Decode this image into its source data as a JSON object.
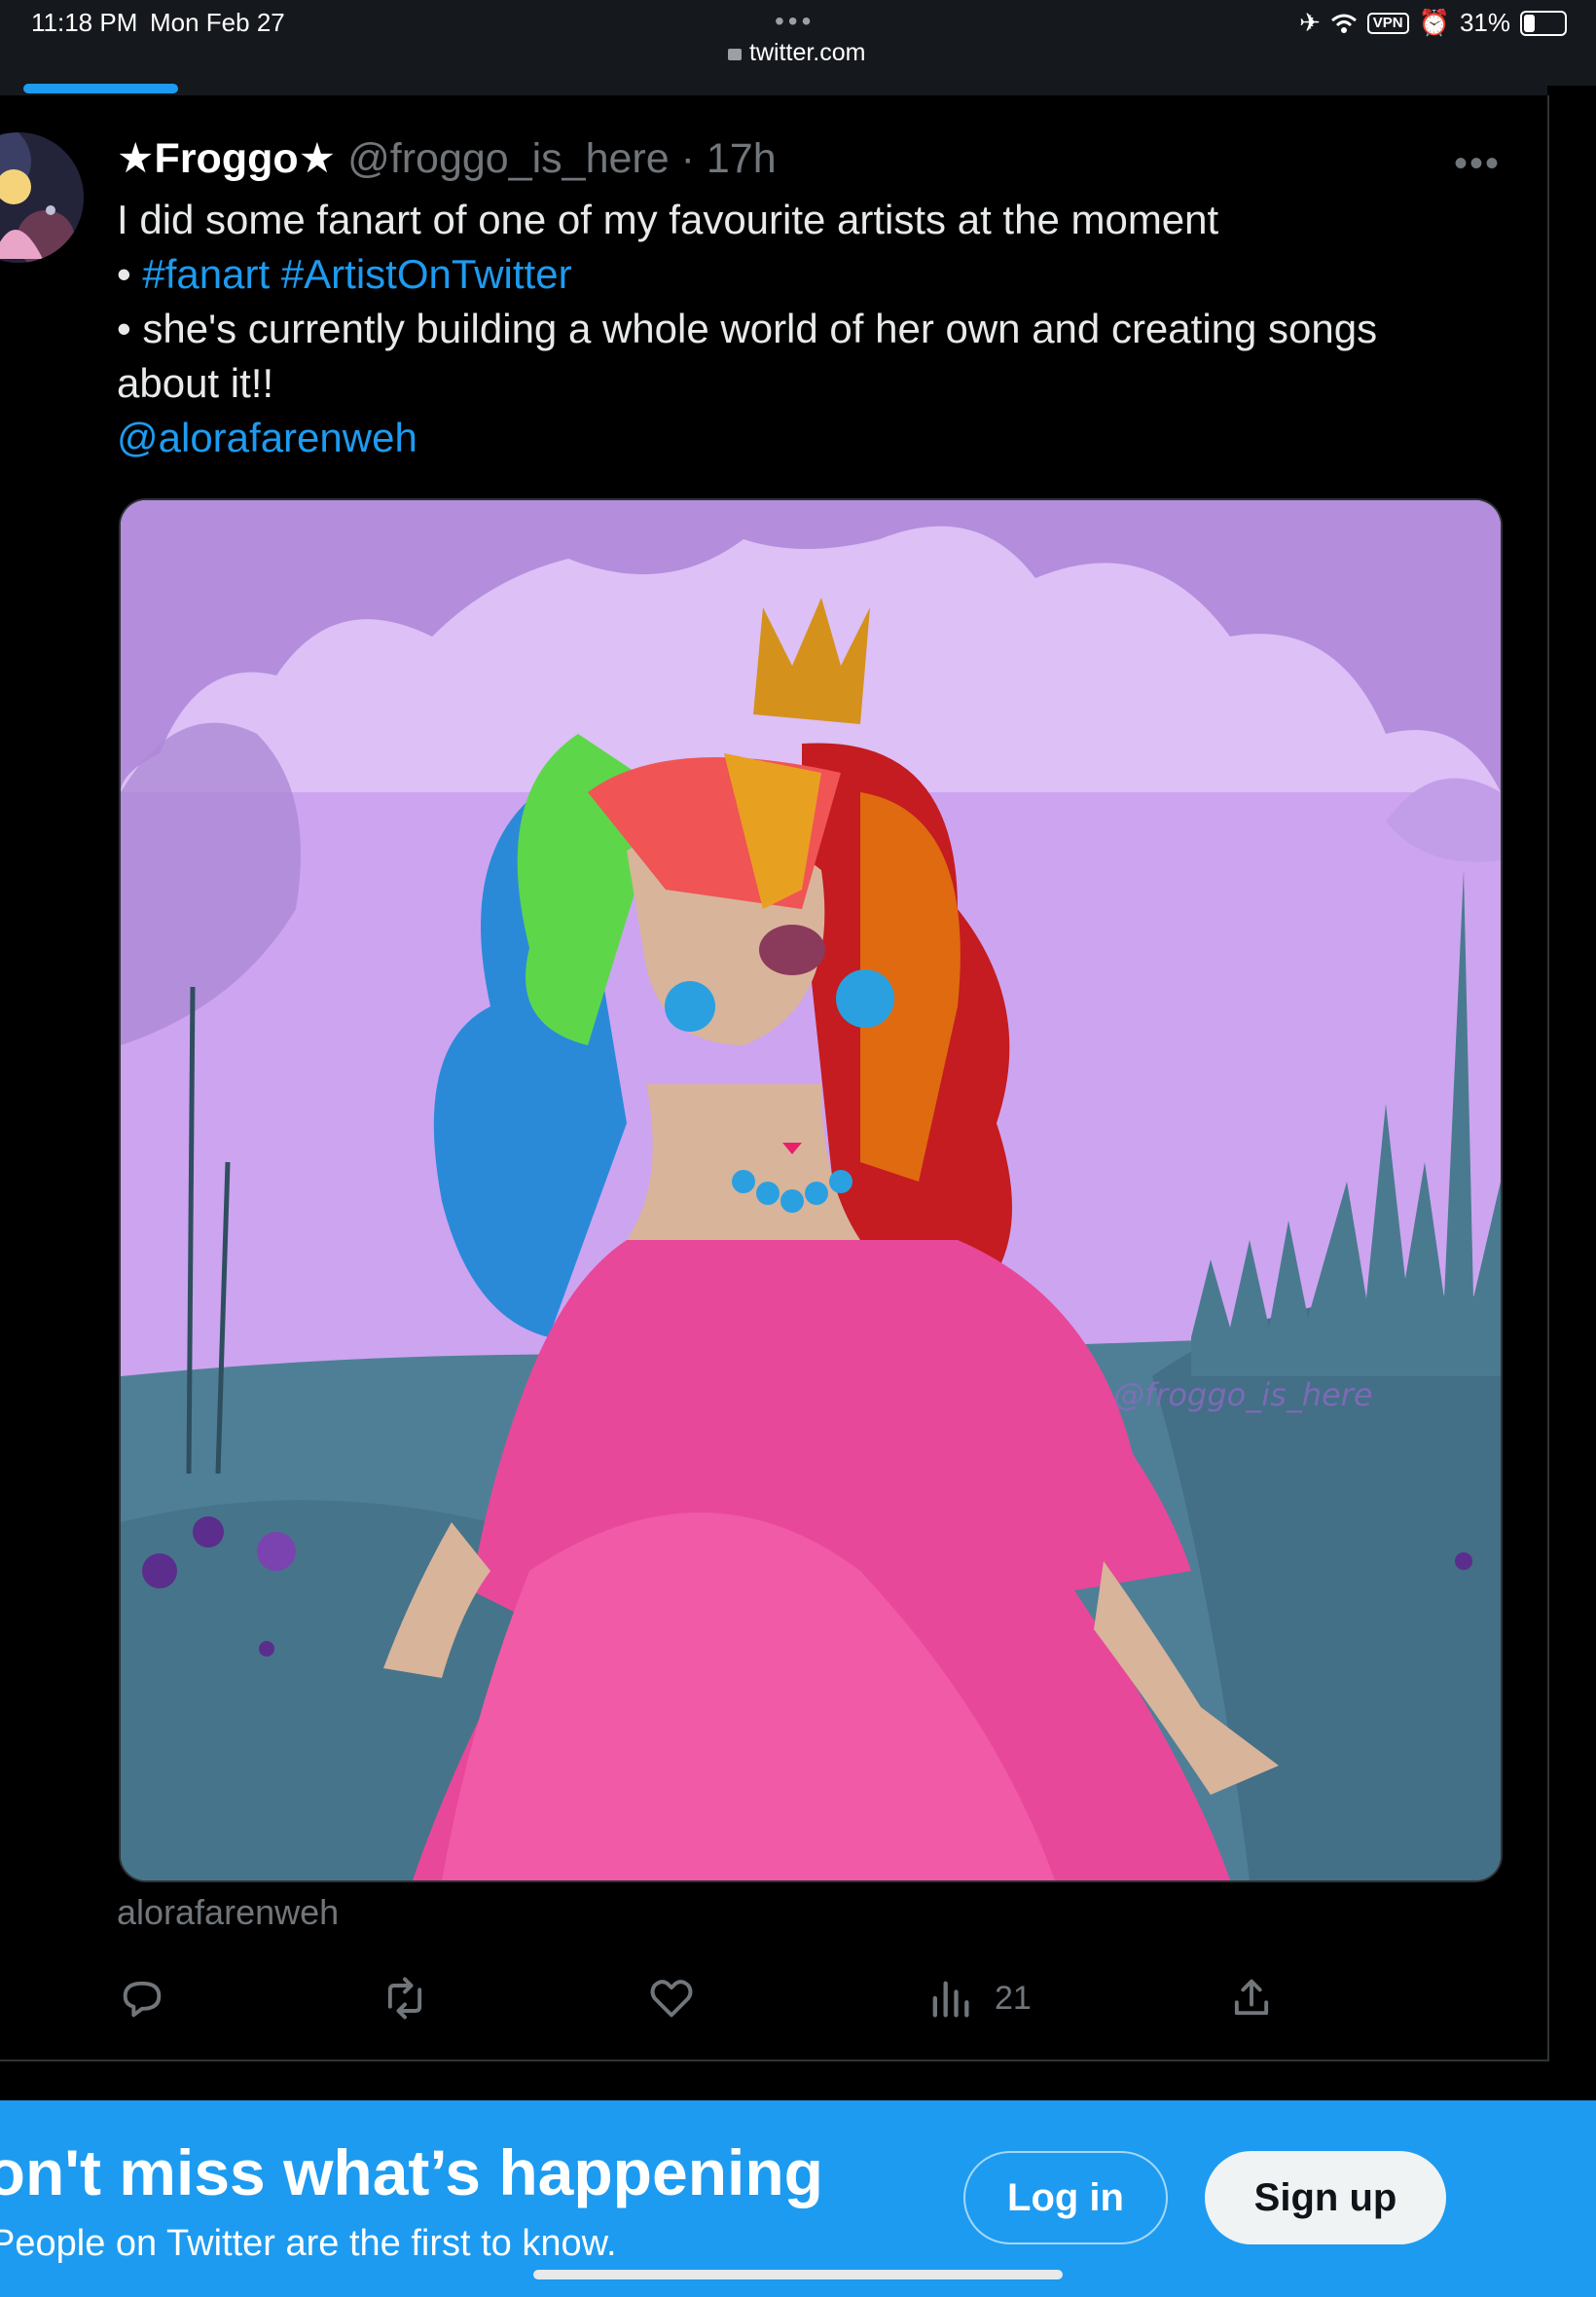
{
  "status_bar": {
    "time": "11:18 PM",
    "date": "Mon Feb 27",
    "url": "twitter.com",
    "vpn": "VPN",
    "battery": "31%",
    "battery_level": 0.31
  },
  "page_load_progress": 0.1,
  "tweet": {
    "display_name": "★Froggo★",
    "handle": "@froggo_is_here",
    "separator": " · ",
    "time_ago": "17h",
    "line1": "I did some fanart of one of my favourite artists at the moment",
    "bullet": "• ",
    "hashtag1": "#fanart",
    "hashtag2": "#ArtistOnTwitter",
    "line3": "• she's currently building a whole world of her own and creating songs about it!!",
    "mention": "@alorafarenweh",
    "image_caption": "alorafarenweh",
    "image_watermark": "@froggo_is_here",
    "views": "21",
    "icons": [
      "reply-icon",
      "retweet-icon",
      "like-icon",
      "views-icon",
      "share-icon"
    ]
  },
  "banner": {
    "title": "Don't miss what’s happening",
    "subtitle": "People on Twitter are the first to know.",
    "login_label": "Log in",
    "signup_label": "Sign up"
  },
  "colors": {
    "accent": "#1d9bf0",
    "background": "#000000",
    "muted": "#71767b"
  }
}
